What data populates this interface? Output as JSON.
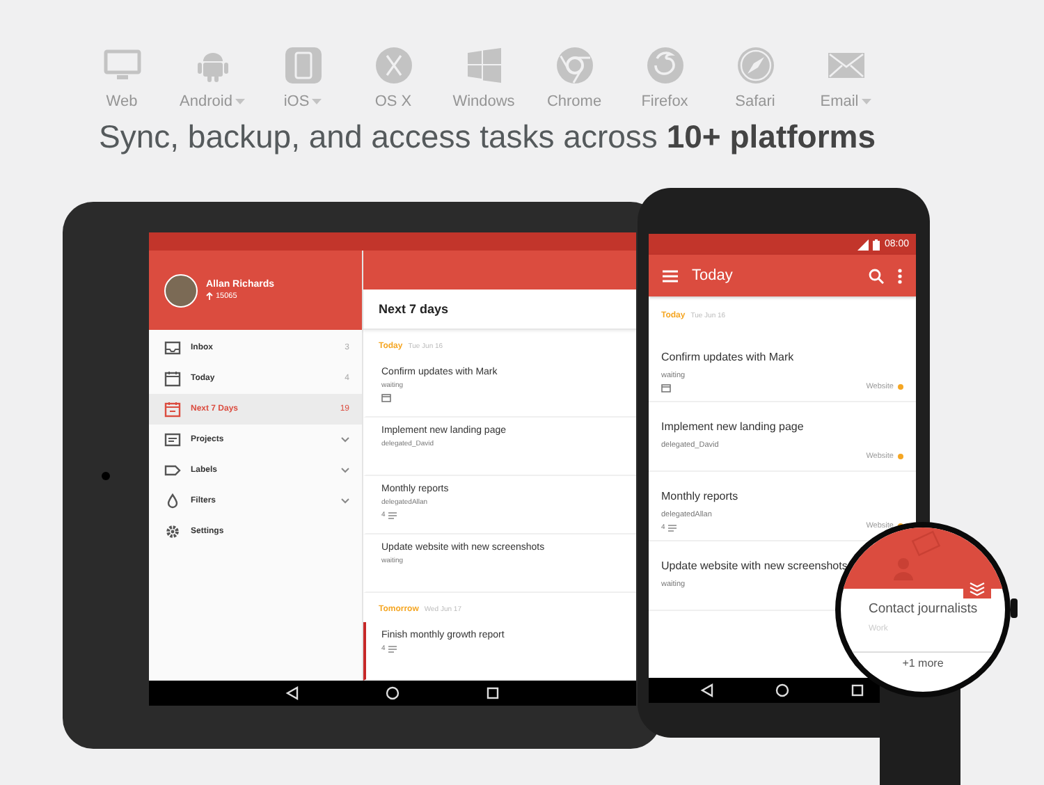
{
  "platforms": [
    {
      "kind": "web",
      "label": "Web",
      "has_menu": false
    },
    {
      "kind": "android",
      "label": "Android",
      "has_menu": true
    },
    {
      "kind": "ios",
      "label": "iOS",
      "has_menu": true
    },
    {
      "kind": "osx",
      "label": "OS X",
      "has_menu": false
    },
    {
      "kind": "windows",
      "label": "Windows",
      "has_menu": false
    },
    {
      "kind": "chrome",
      "label": "Chrome",
      "has_menu": false
    },
    {
      "kind": "firefox",
      "label": "Firefox",
      "has_menu": false
    },
    {
      "kind": "safari",
      "label": "Safari",
      "has_menu": false
    },
    {
      "kind": "email",
      "label": "Email",
      "has_menu": true
    }
  ],
  "headline": "Sync, backup, and access tasks across **10+ platforms**",
  "tablet": {
    "user": {
      "name": "Allan Richards",
      "karma": "15065"
    },
    "nav": [
      {
        "kind": "inbox",
        "label": "Inbox",
        "count": "3",
        "expandable": false,
        "selected": false
      },
      {
        "kind": "today",
        "label": "Today",
        "count": "4",
        "expandable": false,
        "selected": false
      },
      {
        "kind": "week",
        "label": "Next 7 Days",
        "count": "19",
        "expandable": false,
        "selected": true
      },
      {
        "kind": "projects",
        "label": "Projects",
        "expandable": true,
        "selected": false
      },
      {
        "kind": "labels",
        "label": "Labels",
        "expandable": true,
        "selected": false
      },
      {
        "kind": "filters",
        "label": "Filters",
        "expandable": true,
        "selected": false
      },
      {
        "kind": "settings",
        "label": "Settings",
        "expandable": false,
        "selected": false
      }
    ],
    "title": "Next 7 days",
    "sections": [
      {
        "day": "Today",
        "date": "Tue Jun 16",
        "tasks": [
          {
            "title": "Confirm updates with Mark",
            "note": "waiting",
            "attachment": true,
            "flagged": false
          },
          {
            "title": "Implement new landing page",
            "note": "delegated_David",
            "attachment": false,
            "flagged": false
          },
          {
            "title": "Monthly reports",
            "note": "delegatedAllan",
            "comments": "4",
            "attachment": false,
            "flagged": false
          },
          {
            "title": "Update website with new screenshots",
            "note": "waiting",
            "attachment": false,
            "flagged": false
          }
        ]
      },
      {
        "day": "Tomorrow",
        "date": "Wed Jun 17",
        "tasks": [
          {
            "title": "Finish monthly growth report",
            "comments": "4",
            "attachment": false,
            "flagged": true
          }
        ]
      }
    ]
  },
  "phone": {
    "time": "08:00",
    "title": "Today",
    "section": {
      "day": "Today",
      "date": "Tue Jun 16"
    },
    "tasks": [
      {
        "title": "Confirm updates with Mark",
        "note": "waiting",
        "attachment": true,
        "project": "Website",
        "color": "#f5a623"
      },
      {
        "title": "Implement new landing page",
        "note": "delegated_David",
        "attachment": false,
        "project": "Website",
        "color": "#f5a623"
      },
      {
        "title": "Monthly reports",
        "note": "delegatedAllan",
        "comments": "4",
        "attachment": false,
        "project": "Website",
        "color": "#f5a623"
      },
      {
        "title": "Update website with new screenshots",
        "note": "waiting",
        "attachment": false
      }
    ]
  },
  "watch": {
    "task": "Contact journalists",
    "project": "Work",
    "more": "+1 more"
  }
}
